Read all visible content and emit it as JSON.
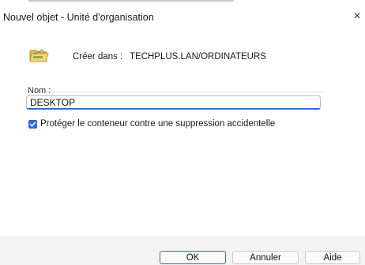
{
  "window": {
    "title": "Nouvel objet - Unité d'organisation",
    "close_glyph": "×"
  },
  "header": {
    "icon": "folder-icon",
    "create_in_label": "Créer dans :",
    "create_in_value": "TECHPLUS.LAN/ORDINATEURS"
  },
  "form": {
    "name_label": "Nom :",
    "name_value": "DESKTOP",
    "protect_label": "Protéger le conteneur contre une suppression accidentelle",
    "protect_checked": true
  },
  "buttons": {
    "ok": "OK",
    "cancel": "Annuler",
    "help": "Aide"
  },
  "colors": {
    "accent": "#2f6bd3",
    "footer_bg": "#f3f3f3"
  }
}
